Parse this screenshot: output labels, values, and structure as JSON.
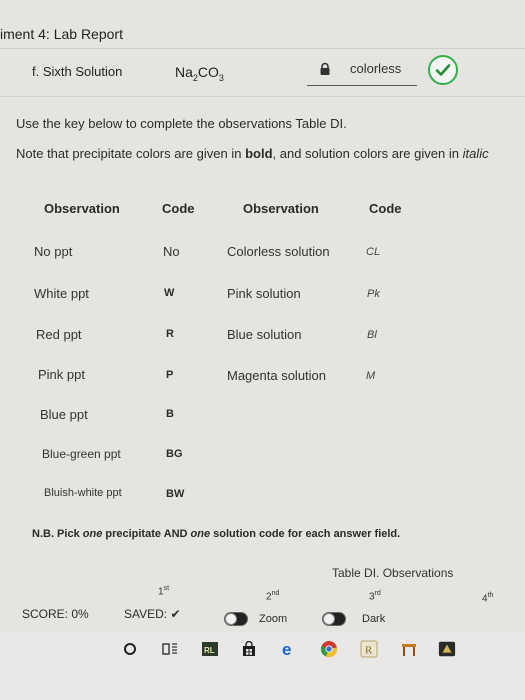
{
  "header": {
    "title": "iment 4: Lab Report"
  },
  "solution_row": {
    "label": "f. Sixth Solution",
    "formula_main": "Na",
    "formula_sub1": "2",
    "formula_mid": "CO",
    "formula_sub2": "3",
    "answer_value": "colorless",
    "status": "correct"
  },
  "instructions": {
    "line1": "Use the key below to complete the observations Table DI.",
    "line2_a": "Note that precipitate colors are given in ",
    "line2_bold": "bold",
    "line2_b": ", and solution colors are given in ",
    "line2_italic": "italic"
  },
  "key_table": {
    "headers": [
      "Observation",
      "Code",
      "Observation",
      "Code"
    ],
    "precipitates": [
      {
        "observation": "No ppt",
        "code": "No"
      },
      {
        "observation": "White ppt",
        "code": "W"
      },
      {
        "observation": "Red ppt",
        "code": "R"
      },
      {
        "observation": "Pink ppt",
        "code": "P"
      },
      {
        "observation": "Blue ppt",
        "code": "B"
      },
      {
        "observation": "Blue-green ppt",
        "code": "BG"
      },
      {
        "observation": "Bluish-white ppt",
        "code": "BW"
      }
    ],
    "solutions": [
      {
        "observation": "Colorless solution",
        "code": "CL"
      },
      {
        "observation": "Pink solution",
        "code": "Pk"
      },
      {
        "observation": "Blue solution",
        "code": "Bl"
      },
      {
        "observation": "Magenta solution",
        "code": "M"
      }
    ]
  },
  "note": {
    "prefix": "N.B. Pick ",
    "one1": "one",
    "mid": " precipitate AND ",
    "one2": "one",
    "suffix": " solution code for each answer field."
  },
  "observations_table": {
    "caption": "Table DI. Observations",
    "columns": [
      {
        "num": "1",
        "sup": "st"
      },
      {
        "num": "2",
        "sup": "nd"
      },
      {
        "num": "3",
        "sup": "rd"
      },
      {
        "num": "4",
        "sup": "th"
      }
    ]
  },
  "footer": {
    "score": "SCORE: 0%",
    "saved": "SAVED: ✔",
    "zoom_label": "Zoom",
    "dark_label": "Dark"
  },
  "taskbar": {
    "icons": [
      "start-circle-icon",
      "task-view-icon",
      "app-rl-icon",
      "store-bag-icon",
      "edge-browser-icon",
      "chrome-browser-icon",
      "app-r-icon",
      "app-shelf-icon",
      "app-dark-icon"
    ]
  },
  "colors": {
    "accent_green": "#2fb24a",
    "background": "#e6e4e1"
  }
}
